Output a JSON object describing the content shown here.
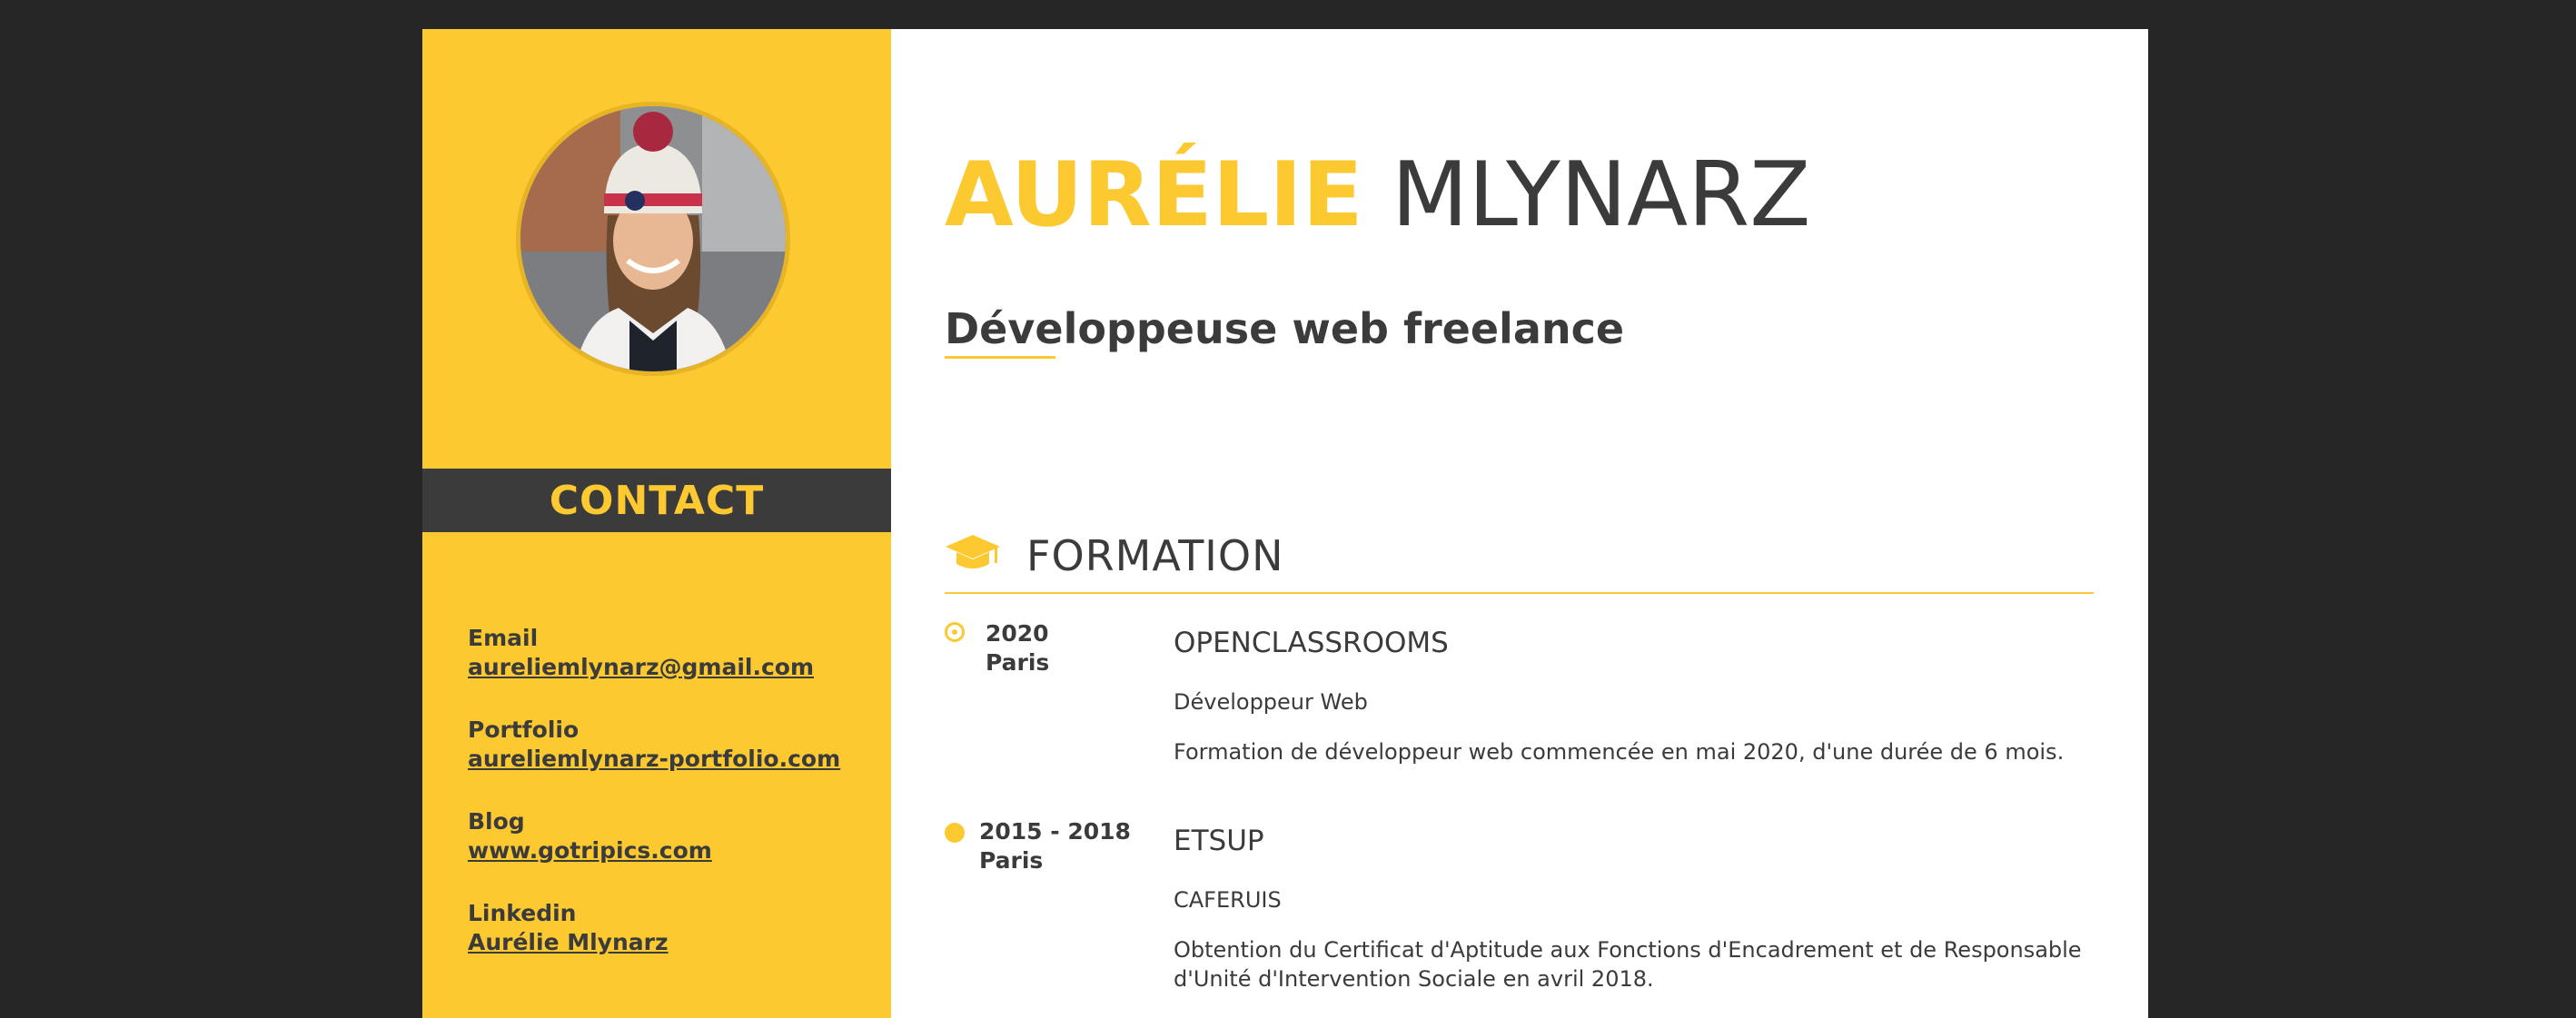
{
  "person": {
    "first_name": "AURÉLIE",
    "last_name": "MLYNARZ",
    "job_title": "Développeuse web freelance"
  },
  "sidebar": {
    "contact_title": "CONTACT",
    "items": [
      {
        "label": "Email",
        "value": "aureliemlynarz@gmail.com"
      },
      {
        "label": "Portfolio",
        "value": "aureliemlynarz-portfolio.com"
      },
      {
        "label": "Blog",
        "value": "www.gotripics.com"
      },
      {
        "label": "Linkedin",
        "value": "Aurélie Mlynarz"
      }
    ]
  },
  "formation": {
    "title": "FORMATION",
    "icon": "graduation-cap-icon",
    "entries": [
      {
        "year": "2020",
        "city": "Paris",
        "school": "OPENCLASSROOMS",
        "degree": "Développeur Web",
        "description": "Formation de développeur web commencée en mai 2020, d'une durée de 6 mois."
      },
      {
        "year": "2015 - 2018",
        "city": "Paris",
        "school": "ETSUP",
        "degree": "CAFERUIS",
        "description": "Obtention du Certificat d'Aptitude aux Fonctions d'Encadrement et de Responsable d'Unité d'Intervention Sociale en avril 2018."
      }
    ]
  },
  "colors": {
    "accent": "#fdc931",
    "dark": "#3b3b3b",
    "background": "#262626",
    "page": "#ffffff"
  }
}
